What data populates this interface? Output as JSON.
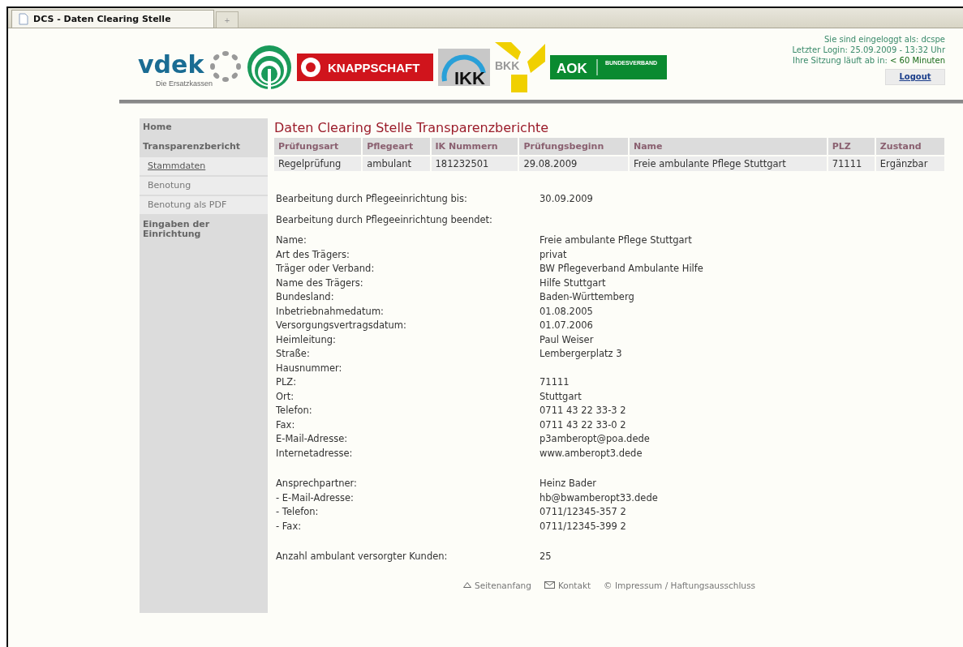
{
  "browser": {
    "tab_title": "DCS - Daten Clearing Stelle",
    "new_tab": "+"
  },
  "logos": [
    {
      "kind": "vdek",
      "text": "vdek",
      "subtitle": "Die Ersatzkassen"
    },
    {
      "kind": "rings"
    },
    {
      "kind": "knappschaft",
      "text": "KNAPPSCHAFT"
    },
    {
      "kind": "ikk",
      "text": "IKK"
    },
    {
      "kind": "bkk",
      "text": "BKK"
    },
    {
      "kind": "aok",
      "text": "AOK",
      "subtitle": "BUNDESVERBAND"
    }
  ],
  "session": {
    "user": "Sie sind eingeloggt als: dcspe",
    "last_login": "Letzter Login: 25.09.2009 - 13:32 Uhr",
    "expires_label": "Ihre Sitzung läuft ab in:",
    "expires_value": "< 60 Minuten",
    "logout": "Logout"
  },
  "sidebar": {
    "items": [
      {
        "label": "Home",
        "kind": "section",
        "selected": false
      },
      {
        "label": "Transparenzbericht",
        "kind": "section",
        "selected": false
      },
      {
        "label": "Stammdaten",
        "kind": "sub",
        "selected": true
      },
      {
        "label": "Benotung",
        "kind": "sub",
        "selected": false
      },
      {
        "label": "Benotung als PDF",
        "kind": "sub",
        "selected": false
      },
      {
        "label": "Eingaben der Einrichtung",
        "kind": "section",
        "selected": false
      }
    ]
  },
  "page_title": "Daten Clearing Stelle Transparenzberichte",
  "table": {
    "columns": [
      "Prüfungsart",
      "Pflegeart",
      "IK Nummern",
      "Prüfungsbeginn",
      "Name",
      "PLZ",
      "Zustand"
    ],
    "rows": [
      [
        "Regelprüfung",
        "ambulant",
        "181232501",
        "29.08.2009",
        "Freie ambulante Pflege Stuttgart",
        "71111",
        "Ergänzbar"
      ]
    ]
  },
  "details": [
    {
      "rows": [
        {
          "label": "Bearbeitung durch Pflegeeinrichtung bis:",
          "value": "30.09.2009"
        }
      ]
    },
    {
      "rows": [
        {
          "label": "Bearbeitung durch Pflegeeinrichtung beendet:"
        }
      ]
    },
    {
      "rows": [
        {
          "label": "Name:",
          "value": "Freie ambulante Pflege Stuttgart"
        },
        {
          "label": "Art des Trägers:",
          "value": "privat"
        },
        {
          "label": "Träger oder Verband:",
          "value": "BW Pflegeverband Ambulante Hilfe"
        },
        {
          "label": "Name des Trägers:",
          "value": "Hilfe Stuttgart"
        },
        {
          "label": "Bundesland:",
          "value": "Baden-Württemberg"
        },
        {
          "label": "Inbetriebnahmedatum:",
          "value": "01.08.2005"
        },
        {
          "label": "Versorgungsvertragsdatum:",
          "value": "01.07.2006"
        },
        {
          "label": "Heimleitung:",
          "value": "Paul Weiser"
        },
        {
          "label": "Straße:",
          "value": "Lembergerplatz 3"
        },
        {
          "label": "Hausnummer:"
        },
        {
          "label": "PLZ:",
          "value": "71111"
        },
        {
          "label": "Ort:",
          "value": "Stuttgart"
        },
        {
          "label": "Telefon:",
          "value": "0711 43 22 33-3 2"
        },
        {
          "label": "Fax:",
          "value": "0711 43 22 33-0 2"
        },
        {
          "label": "E-Mail-Adresse:",
          "value": "p3amberopt@poa.dede"
        },
        {
          "label": "Internetadresse:",
          "value": "www.amberopt3.dede"
        }
      ]
    },
    {
      "rows": [
        {
          "label": "Ansprechpartner:",
          "value": "Heinz Bader"
        },
        {
          "label": "- E-Mail-Adresse:",
          "value": "hb@bwamberopt33.dede"
        },
        {
          "label": "- Telefon:",
          "value": "0711/12345-357 2"
        },
        {
          "label": "- Fax:",
          "value": "0711/12345-399 2"
        }
      ]
    },
    {
      "rows": [
        {
          "label": "Anzahl ambulant versorgter Kunden:",
          "value": "25"
        }
      ]
    }
  ],
  "footer": [
    {
      "kind": "top",
      "label": "Seitenanfang"
    },
    {
      "kind": "mail",
      "label": "Kontakt"
    },
    {
      "kind": "copyright",
      "label": "© Impressum / Haftungsausschluss"
    }
  ]
}
